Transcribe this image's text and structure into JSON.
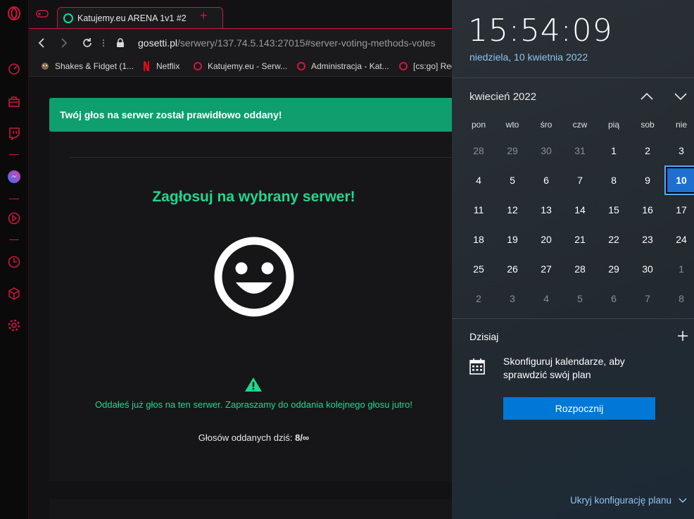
{
  "browser": {
    "tab_title": "Katujemy.eu ARENA 1v1 #2",
    "tab_new": "+",
    "url_host": "gosetti.pl",
    "url_path": "/serwery/137.74.5.143:27015#server-voting-methods-votes",
    "bookmarks": [
      {
        "label": "Shakes & Fidget (1...",
        "icon": "shakes-fidget-icon"
      },
      {
        "label": "Netflix",
        "icon": "netflix-icon"
      },
      {
        "label": "Katujemy.eu - Serw...",
        "icon": "katujemy-icon"
      },
      {
        "label": "Administracja - Kat...",
        "icon": "katujemy-icon"
      },
      {
        "label": "[cs:go] Reg",
        "icon": "katujemy-icon"
      }
    ]
  },
  "page": {
    "alert": "Twój głos na serwer został prawidłowo oddany!",
    "heading": "Zagłosuj na wybrany serwer!",
    "voted_message": "Oddałeś już głos na ten serwer. Zapraszamy do oddania kolejnego głosu jutro!",
    "votes_label": "Głosów oddanych dziś:",
    "votes_value": "8/∞"
  },
  "flyout": {
    "time": "15:54:09",
    "date_long": "niedziela, 10 kwietnia 2022",
    "month_label": "kwiecień 2022",
    "weekdays": [
      "pon",
      "wto",
      "śro",
      "czw",
      "pią",
      "sob",
      "nie"
    ],
    "weeks": [
      [
        "28",
        "29",
        "30",
        "31",
        "1",
        "2",
        "3"
      ],
      [
        "4",
        "5",
        "6",
        "7",
        "8",
        "9",
        "10"
      ],
      [
        "11",
        "12",
        "13",
        "14",
        "15",
        "16",
        "17"
      ],
      [
        "18",
        "19",
        "20",
        "21",
        "22",
        "23",
        "24"
      ],
      [
        "25",
        "26",
        "27",
        "28",
        "29",
        "30",
        "1"
      ],
      [
        "2",
        "3",
        "4",
        "5",
        "6",
        "7",
        "8"
      ]
    ],
    "today_day": "10",
    "today_label": "Dzisiaj",
    "config_text": "Skonfiguruj kalendarze, aby sprawdzić swój plan",
    "start_button": "Rozpocznij",
    "hide_plan": "Ukryj konfigurację planu"
  },
  "colors": {
    "accent_red": "#d0163a",
    "success_green": "#0f9e6e",
    "heading_green": "#1fd88f",
    "windows_blue": "#0078d7"
  }
}
